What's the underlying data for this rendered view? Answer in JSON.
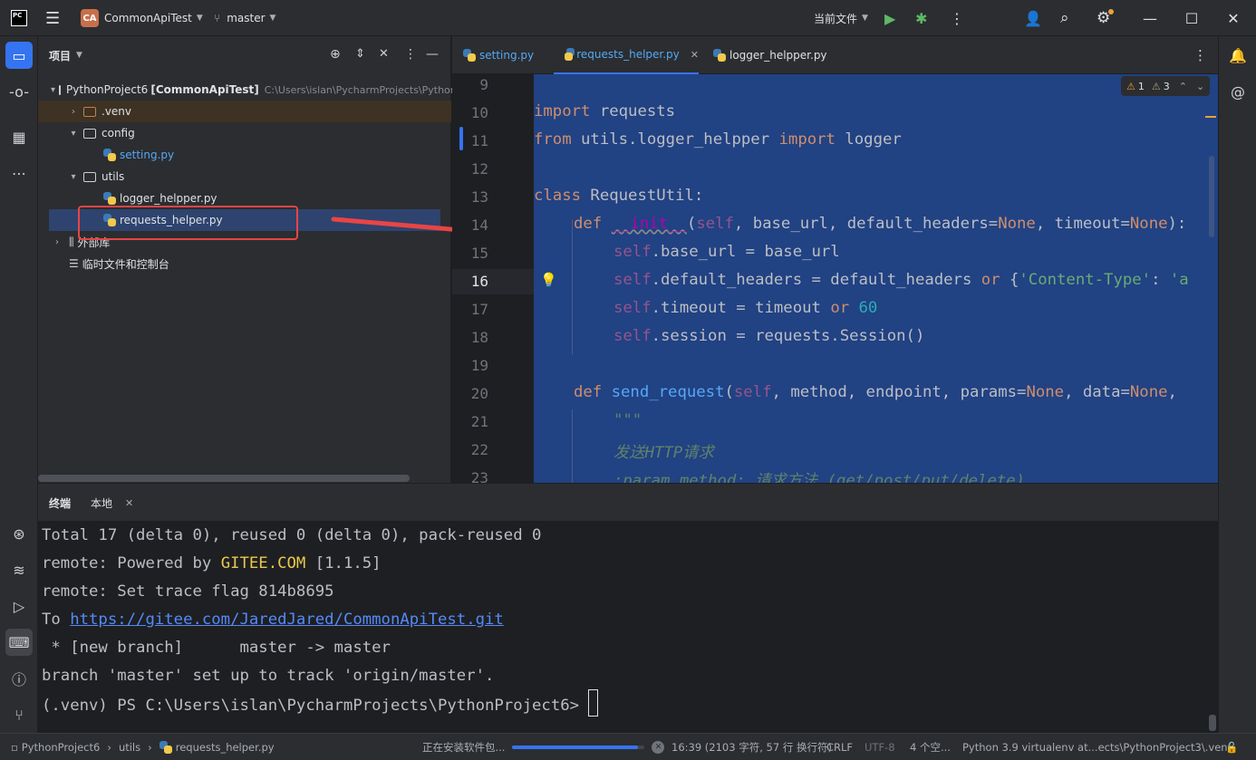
{
  "titlebar": {
    "logo": "PC",
    "project_badge": "CA",
    "project_name": "CommonApiTest",
    "branch": "master",
    "run_config": "当前文件"
  },
  "project_panel": {
    "title": "项目",
    "items": [
      {
        "label": "PythonProject6",
        "bold": "[CommonApiTest]",
        "path": "C:\\Users\\islan\\PycharmProjects\\PythonP"
      },
      {
        "label": ".venv"
      },
      {
        "label": "config"
      },
      {
        "label": "setting.py"
      },
      {
        "label": "utils"
      },
      {
        "label": "logger_helpper.py"
      },
      {
        "label": "requests_helper.py"
      },
      {
        "label": "外部库"
      },
      {
        "label": "临时文件和控制台"
      }
    ]
  },
  "tabs": [
    {
      "label": "setting.py"
    },
    {
      "label": "requests_helper.py"
    },
    {
      "label": "logger_helpper.py"
    }
  ],
  "inspections": {
    "warnings": "1",
    "weak_warnings": "3"
  },
  "editor": {
    "line_numbers": [
      "9",
      "10",
      "11",
      "12",
      "13",
      "14",
      "15",
      "16",
      "17",
      "18",
      "19",
      "20",
      "21",
      "22",
      "23"
    ],
    "lines": {
      "l10_a": "import",
      "l10_b": " requests",
      "l11_a": "from",
      "l11_b": " utils.logger_helpper ",
      "l11_c": "import",
      "l11_d": " logger",
      "l13_a": "class",
      "l13_b": " RequestUtil:",
      "l14_a": "def",
      "l14_b": "__init__",
      "l14_c": "(",
      "l14_d": "self",
      "l14_e": ", base_url, default_headers=",
      "l14_f": "None",
      "l14_g": ", timeout=",
      "l14_h": "None",
      "l14_i": "):",
      "l15_a": "self",
      "l15_b": ".base_url = base_url",
      "l16_a": "self",
      "l16_b": ".default_headers = default_headers ",
      "l16_c": "or",
      "l16_d": " {",
      "l16_e": "'Content-Type'",
      "l16_f": ": ",
      "l16_g": "'a",
      "l17_a": "self",
      "l17_b": ".timeout = timeout ",
      "l17_c": "or",
      "l17_d": " ",
      "l17_e": "60",
      "l18_a": "self",
      "l18_b": ".session = requests.Session()",
      "l20_a": "def",
      "l20_b": "send_request",
      "l20_c": "(",
      "l20_d": "self",
      "l20_e": ", method, endpoint, params=",
      "l20_f": "None",
      "l20_g": ", data=",
      "l20_h": "None",
      "l20_i": ",",
      "l21": "\"\"\"",
      "l22": "发送HTTP请求",
      "l23": ":param method: 请求方法 (get/post/put/delete)"
    }
  },
  "terminal": {
    "tab_label": "终端",
    "local_tab": "本地",
    "lines": [
      "Total 17 (delta 0), reused 0 (delta 0), pack-reused 0",
      "remote: Powered by ",
      "GITEE.COM",
      " [1.1.5]",
      "remote: Set trace flag 814b8695",
      "To ",
      "https://gitee.com/JaredJared/CommonApiTest.git",
      " * [new branch]      master -> master",
      "branch 'master' set up to track 'origin/master'.",
      "(.venv) PS C:\\Users\\islan\\PycharmProjects\\PythonProject6> "
    ]
  },
  "statusbar": {
    "crumb_project": "PythonProject6",
    "crumb_folder": "utils",
    "crumb_file": "requests_helper.py",
    "task": "正在安装软件包...",
    "task_progress": 0.95,
    "position": "16:39 (2103 字符, 57 行 换行符)",
    "line_sep": "CRLF",
    "encoding": "UTF-8",
    "indent": "4 个空...",
    "interpreter": "Python 3.9 virtualenv at...ects\\PythonProject3\\.venv"
  },
  "colors": {
    "selection": "#214283",
    "annotation_red": "#e84545"
  }
}
